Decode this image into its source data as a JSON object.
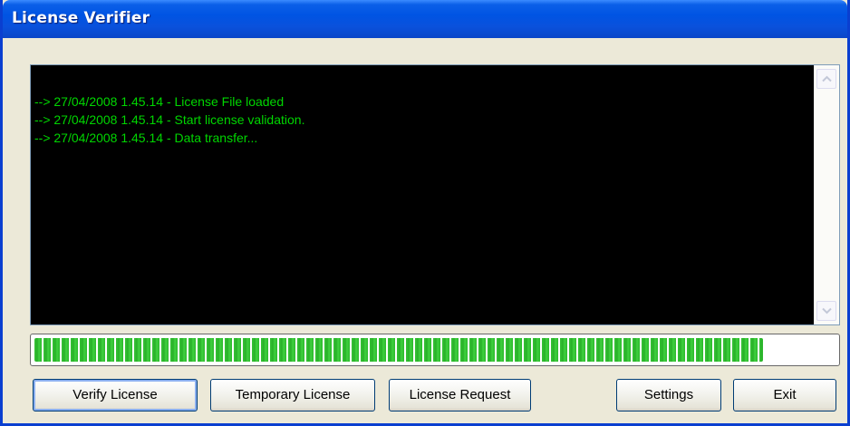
{
  "window": {
    "title": "License Verifier"
  },
  "log": {
    "lines": [
      "--> 27/04/2008 1.45.14 - License File loaded",
      "--> 27/04/2008 1.45.14 - Start license validation.",
      "--> 27/04/2008 1.45.14 - Data transfer..."
    ],
    "text_color": "#00d600",
    "background_color": "#000000"
  },
  "progress": {
    "percent": 91,
    "color": "#37c337"
  },
  "buttons": {
    "verify_license": "Verify License",
    "temporary_license": "Temporary License",
    "license_request": "License Request",
    "settings": "Settings",
    "exit": "Exit"
  },
  "colors": {
    "title_bar": "#0054e3",
    "window_background": "#ece9d8"
  },
  "icons": {
    "scroll_up": "chevron-up-icon",
    "scroll_down": "chevron-down-icon"
  }
}
